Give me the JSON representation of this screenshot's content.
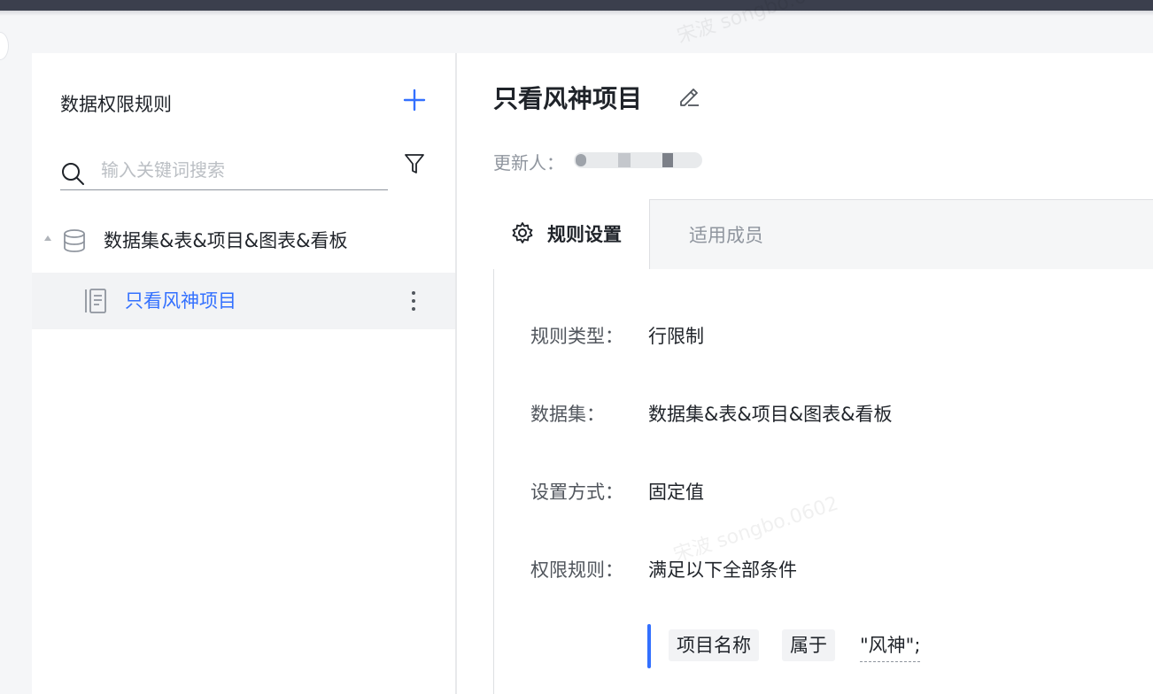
{
  "sidebar": {
    "title": "数据权限规则",
    "search_placeholder": "输入关键词搜索",
    "tree": {
      "group_label": "数据集&表&项目&图表&看板",
      "items": [
        {
          "label": "只看风神项目"
        }
      ]
    }
  },
  "main": {
    "title": "只看风神项目",
    "updater_label": "更新人：",
    "tabs": [
      {
        "label": "规则设置",
        "active": true
      },
      {
        "label": "适用成员",
        "active": false
      }
    ],
    "details": [
      {
        "key": "规则类型：",
        "value": "行限制"
      },
      {
        "key": "数据集：",
        "value": "数据集&表&项目&图表&看板"
      },
      {
        "key": "设置方式：",
        "value": "固定值"
      },
      {
        "key": "权限规则：",
        "value": "满足以下全部条件"
      }
    ],
    "condition": {
      "field": "项目名称",
      "operator": "属于",
      "value": "\"风神\";"
    }
  },
  "watermark": "宋波 songbo.0602",
  "colors": {
    "accent": "#3370ff",
    "text": "#1f2329",
    "muted": "#8f959e"
  },
  "icons": [
    "add-icon",
    "search-icon",
    "filter-icon",
    "database-icon",
    "document-icon",
    "more-vertical-icon",
    "edit-icon",
    "gear-icon"
  ]
}
